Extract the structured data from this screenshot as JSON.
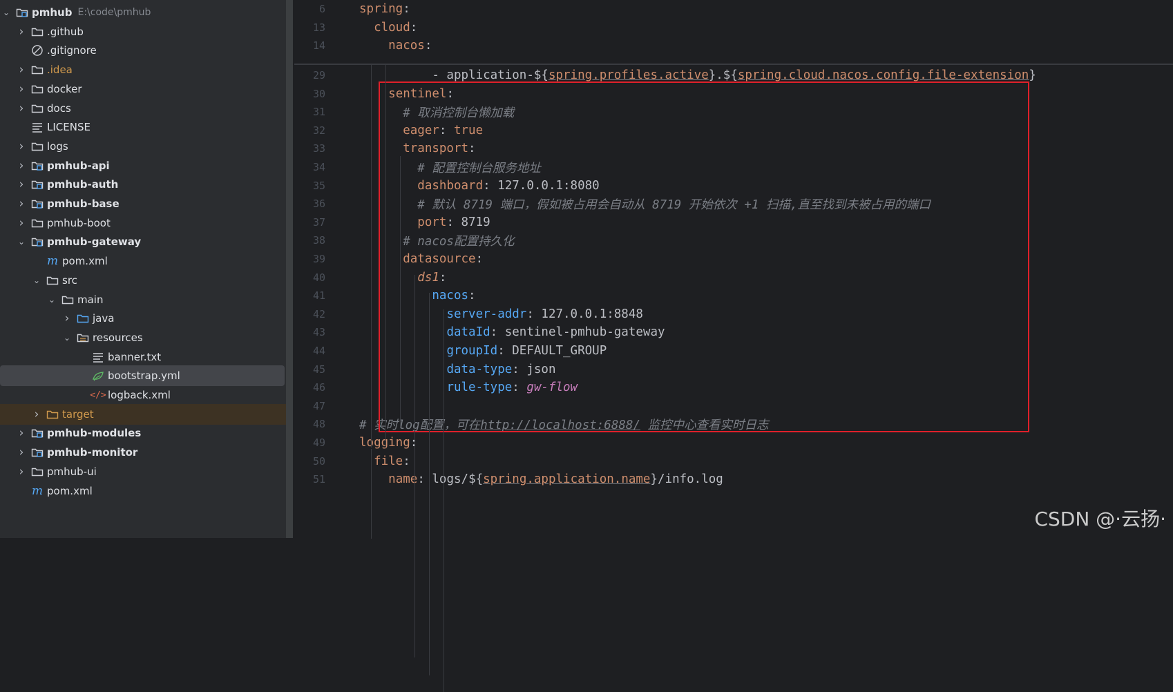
{
  "tree": {
    "items": [
      {
        "label": "pmhub",
        "path": "E:\\code\\pmhub",
        "bold": true,
        "chev": "v",
        "icon": "module-folder-icon"
      },
      {
        "label": ".github",
        "chev": ">",
        "icon": "folder-icon"
      },
      {
        "label": ".gitignore",
        "chev": "",
        "icon": "ignore-file-icon"
      },
      {
        "label": ".idea",
        "chev": ">",
        "icon": "folder-icon",
        "orange": true
      },
      {
        "label": "docker",
        "chev": ">",
        "icon": "folder-icon"
      },
      {
        "label": "docs",
        "chev": ">",
        "icon": "folder-icon"
      },
      {
        "label": "LICENSE",
        "chev": "",
        "icon": "text-file-icon"
      },
      {
        "label": "logs",
        "chev": ">",
        "icon": "folder-icon"
      },
      {
        "label": "pmhub-api",
        "chev": ">",
        "icon": "module-folder-icon",
        "bold": true
      },
      {
        "label": "pmhub-auth",
        "chev": ">",
        "icon": "module-folder-icon",
        "bold": true
      },
      {
        "label": "pmhub-base",
        "chev": ">",
        "icon": "module-folder-icon",
        "bold": true
      },
      {
        "label": "pmhub-boot",
        "chev": ">",
        "icon": "folder-icon"
      },
      {
        "label": "pmhub-gateway",
        "chev": "v",
        "icon": "module-folder-icon",
        "bold": true
      },
      {
        "label": "pom.xml",
        "chev": "",
        "icon": "maven-icon"
      },
      {
        "label": "src",
        "chev": "v",
        "icon": "folder-icon"
      },
      {
        "label": "main",
        "chev": "v",
        "icon": "folder-icon"
      },
      {
        "label": "java",
        "chev": ">",
        "icon": "source-folder-icon"
      },
      {
        "label": "resources",
        "chev": "v",
        "icon": "resources-folder-icon"
      },
      {
        "label": "banner.txt",
        "chev": "",
        "icon": "text-file-icon"
      },
      {
        "label": "bootstrap.yml",
        "chev": "",
        "icon": "yaml-file-icon",
        "selected": true
      },
      {
        "label": "logback.xml",
        "chev": "",
        "icon": "xml-file-icon"
      },
      {
        "label": "target",
        "chev": ">",
        "icon": "excluded-folder-icon",
        "orange": true,
        "excluded": true
      },
      {
        "label": "pmhub-modules",
        "chev": ">",
        "icon": "module-folder-icon",
        "bold": true
      },
      {
        "label": "pmhub-monitor",
        "chev": ">",
        "icon": "module-folder-icon",
        "bold": true
      },
      {
        "label": "pmhub-ui",
        "chev": ">",
        "icon": "folder-icon"
      },
      {
        "label": "pom.xml",
        "chev": "",
        "icon": "maven-icon"
      }
    ]
  },
  "editor": {
    "sticky": [
      {
        "n": "6",
        "html": "<span class='k'>spring</span>:"
      },
      {
        "n": "13",
        "html": "  <span class='k'>cloud</span>:"
      },
      {
        "n": "14",
        "html": "    <span class='k'>nacos</span>:"
      }
    ],
    "lines": [
      {
        "n": "29",
        "html": "          - application-${<span class='k u'>spring.profiles.active</span>}.${<span class='k u'>spring.cloud.nacos.config.file-extension</span>}"
      },
      {
        "n": "30",
        "html": "    <span class='k'>sentinel</span>:"
      },
      {
        "n": "31",
        "html": "      <span class='c'># 取消控制台懒加载</span>"
      },
      {
        "n": "32",
        "html": "      <span class='k'>eager</span>: <span class='k'>true</span>"
      },
      {
        "n": "33",
        "html": "      <span class='k'>transport</span>:"
      },
      {
        "n": "34",
        "html": "        <span class='c'># 配置控制台服务地址</span>"
      },
      {
        "n": "35",
        "html": "        <span class='k'>dashboard</span>: 127.0.0.1:8080"
      },
      {
        "n": "36",
        "html": "        <span class='c'># 默认 8719 端口，假如被占用会自动从 8719 开始依次 +1 扫描,直至找到未被占用的端口</span>"
      },
      {
        "n": "37",
        "html": "        <span class='k'>port</span>: 8719"
      },
      {
        "n": "38",
        "html": "      <span class='c'># nacos配置持久化</span>"
      },
      {
        "n": "39",
        "html": "      <span class='k'>datasource</span>:"
      },
      {
        "n": "40",
        "html": "        <span class='orangeI'>ds1</span>:"
      },
      {
        "n": "41",
        "html": "          <span class='blue'>nacos</span>:"
      },
      {
        "n": "42",
        "html": "            <span class='blue'>server-addr</span>: 127.0.0.1:8848"
      },
      {
        "n": "43",
        "html": "            <span class='blue'>dataId</span>: sentinel-pmhub-gateway"
      },
      {
        "n": "44",
        "html": "            <span class='blue'>groupId</span>: DEFAULT_GROUP"
      },
      {
        "n": "45",
        "html": "            <span class='blue'>data-type</span>: json"
      },
      {
        "n": "46",
        "html": "            <span class='blue'>rule-type</span>: <span class='purple'>gw-flow</span>"
      },
      {
        "n": "47",
        "html": ""
      },
      {
        "n": "48",
        "html": "<span class='c'># 实时log配置，可在<span class='link'>http://localhost:6888/</span> 监控中心查看实时日志</span>"
      },
      {
        "n": "49",
        "html": "<span class='k'>logging</span>:"
      },
      {
        "n": "50",
        "html": "  <span class='k'>file</span>:"
      },
      {
        "n": "51",
        "html": "    <span class='k'>name</span>: logs/${<span class='k u'>spring.application.name</span>}/info.log"
      }
    ]
  },
  "watermark": "CSDN @·云扬·"
}
